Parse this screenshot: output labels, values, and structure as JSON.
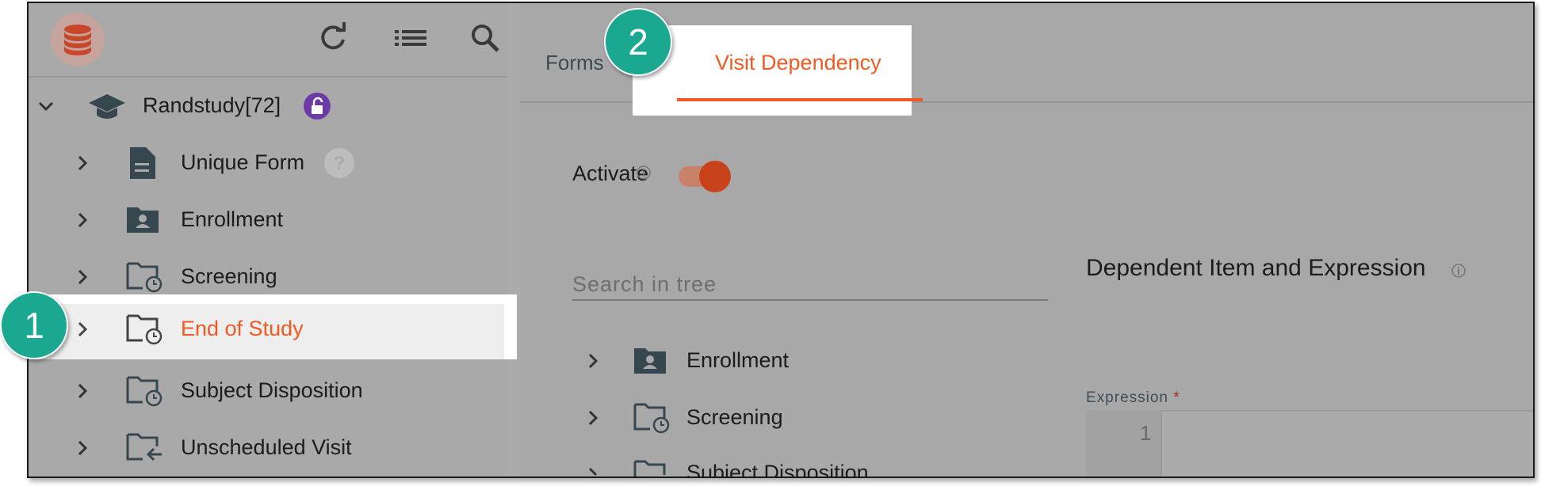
{
  "toolbar": {
    "icons": [
      "database-icon",
      "refresh-icon",
      "list-icon",
      "search-icon"
    ]
  },
  "tree": {
    "study": {
      "label": "Randstudy[72]",
      "icon": "graduation-cap-icon",
      "badge_icon": "unlock-icon"
    },
    "items": [
      {
        "label": "Unique Form",
        "icon": "document-icon",
        "extra_icon": "help-icon"
      },
      {
        "label": "Enrollment",
        "icon": "folder-person-icon"
      },
      {
        "label": "Screening",
        "icon": "folder-clock-icon"
      },
      {
        "label": "End of Study",
        "icon": "folder-clock-icon",
        "selected": true
      },
      {
        "label": "Subject Disposition",
        "icon": "folder-clock-icon"
      },
      {
        "label": "Unscheduled Visit",
        "icon": "folder-arrow-icon"
      }
    ]
  },
  "tabs": [
    {
      "label": "Forms"
    },
    {
      "label": "Visit Dependency",
      "active": true
    }
  ],
  "activate": {
    "label": "Activate",
    "enabled": true
  },
  "search": {
    "placeholder": "Search in tree"
  },
  "tree2": {
    "items": [
      {
        "label": "Enrollment",
        "icon": "folder-person-icon"
      },
      {
        "label": "Screening",
        "icon": "folder-clock-icon"
      },
      {
        "label": "Subject Disposition",
        "icon": "folder-clock-icon"
      }
    ]
  },
  "dependency": {
    "title": "Dependent Item and Expression",
    "expression_label": "Expression",
    "required_mark": "*",
    "line_number": "1"
  },
  "callouts": [
    "1",
    "2"
  ],
  "colors": {
    "accent": "#f05a22",
    "callout": "#1aa891",
    "lock_badge": "#6a3aa6"
  }
}
